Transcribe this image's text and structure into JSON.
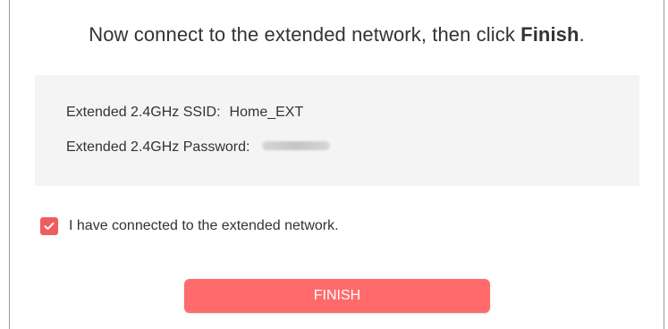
{
  "heading": {
    "prefix": "Now connect to the extended network, then click ",
    "emphasis": "Finish",
    "suffix": "."
  },
  "network_info": {
    "ssid_label": "Extended 2.4GHz SSID:",
    "ssid_value": "Home_EXT",
    "password_label": "Extended 2.4GHz Password:"
  },
  "confirmation": {
    "checked": true,
    "label": "I have connected to the extended network."
  },
  "finish_button": {
    "label": "FINISH"
  },
  "colors": {
    "accent": "#ff6b6b",
    "checkbox": "#f05d5e",
    "panel_bg": "#f4f4f4",
    "text": "#333333"
  }
}
